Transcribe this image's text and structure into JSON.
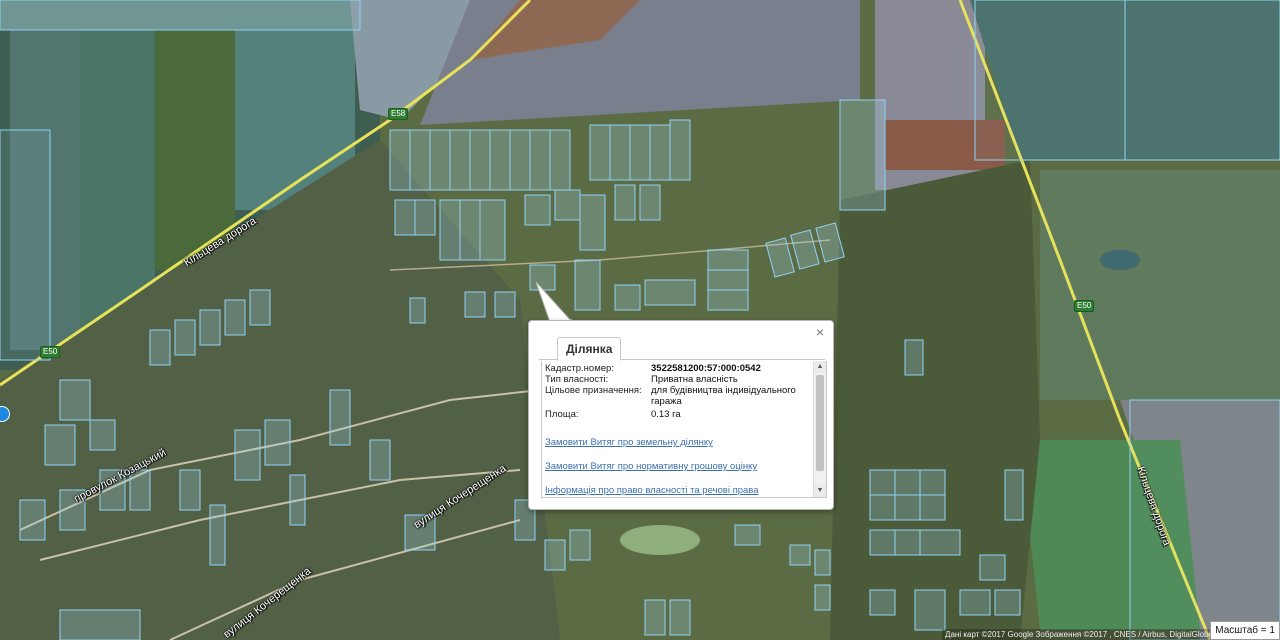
{
  "map": {
    "roads": {
      "kiltseva_left": "Кільцева дорога",
      "kiltseva_right": "Кільцева дорога",
      "provulok": "провулок Козацький",
      "vul_kocherezhenka_1": "вулиця Кочерещенка",
      "vul_kocherezhenka_2": "вулиця Кочерещенка"
    },
    "shields": {
      "e58": "E58",
      "e50_left": "E50",
      "e50_right": "E50"
    },
    "attribution": "Дані карт ©2017 Google Зображення ©2017 , CNES / Airbus, DigitalGlobe",
    "scale": "Масштаб = 1",
    "colors": {
      "parcel_stroke": "#8fd3f5",
      "road": "#e6e25a",
      "popup_link": "#3a6fb0"
    }
  },
  "popup": {
    "close": "×",
    "tab": "Ділянка",
    "fields": {
      "cadastre_label": "Кадастр.номер:",
      "cadastre_value": "3522581200:57:000:0542",
      "ownership_label": "Тип власності:",
      "ownership_value": "Приватна власність",
      "purpose_label": "Цільове призначення:",
      "purpose_value": "для будівництва індивідуального гаража",
      "area_label": "Площа:",
      "area_value": "0.13 га"
    },
    "links": {
      "order_extract": "Замовити Витяг про земельну ділянку",
      "order_valuation": "Замовити Витяг про нормативну грошову оцінку",
      "ownership_info": "Інформація про право власності та речові права"
    }
  }
}
